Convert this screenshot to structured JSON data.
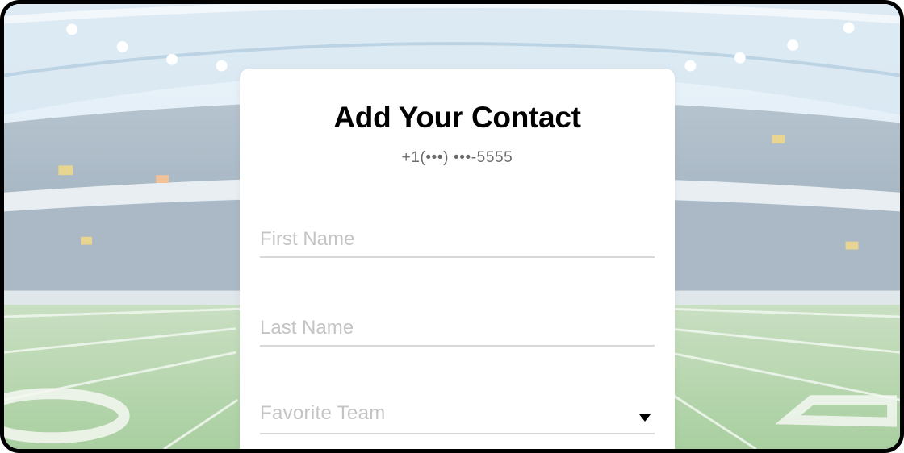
{
  "contact_form": {
    "title": "Add Your Contact",
    "phone": "+1(•••) •••-5555",
    "first_name_placeholder": "First Name",
    "last_name_placeholder": "Last Name",
    "favorite_team_placeholder": "Favorite Team",
    "favorite_team_icon": "chevron-down-icon"
  },
  "background": {
    "image": "football-stadium-photo"
  },
  "colors": {
    "card": "#ffffff",
    "title": "#000000",
    "phone_text": "#6b6b6b",
    "placeholder": "#c4c4c4",
    "underline": "#d8d8d8"
  }
}
